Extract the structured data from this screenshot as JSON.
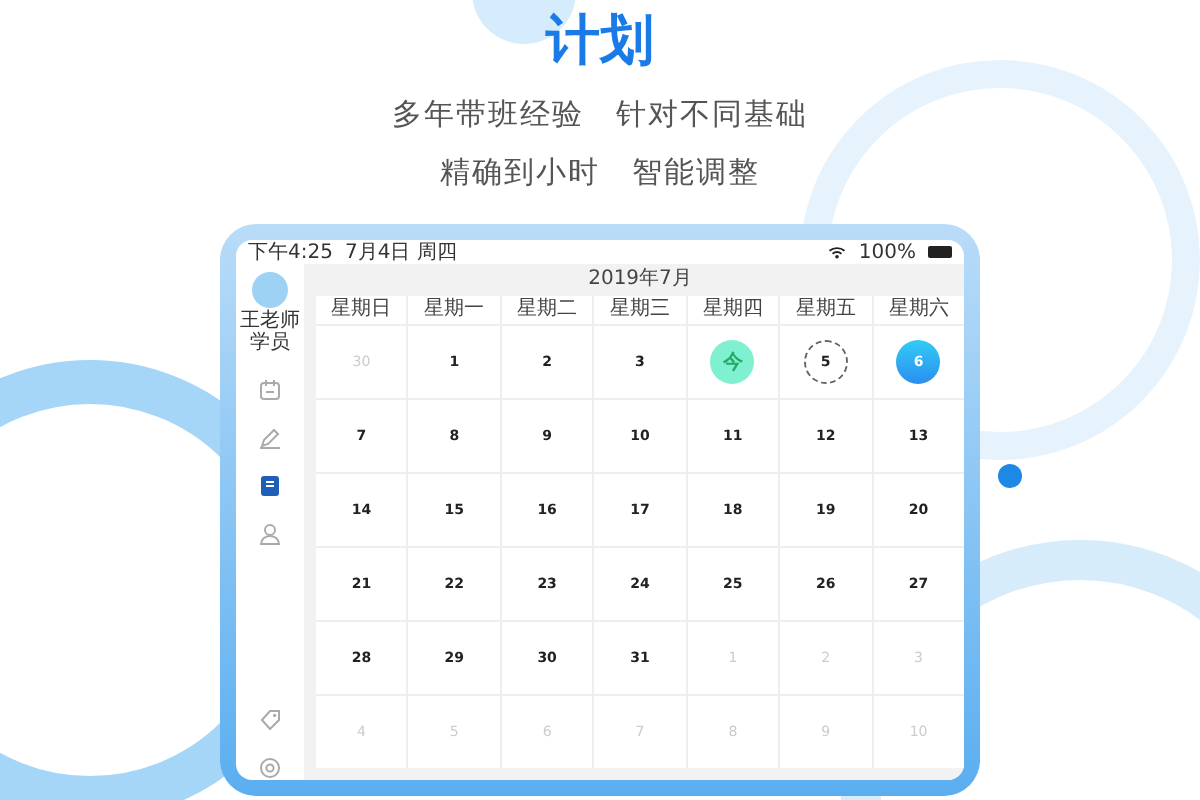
{
  "header": {
    "title": "计划",
    "lines": [
      "多年带班经验　针对不同基础",
      "精确到小时　智能调整"
    ]
  },
  "status_bar": {
    "time": "下午4:25",
    "date": "7月4日 周四",
    "battery": "100%"
  },
  "sidebar": {
    "user_name": "王老师学员",
    "items": [
      {
        "selected": false
      },
      {
        "selected": false
      },
      {
        "selected": true
      },
      {
        "selected": false
      }
    ],
    "bottom_items": [
      {
        "selected": false
      },
      {
        "selected": false
      }
    ]
  },
  "calendar": {
    "month": "2019年7月",
    "weekdays": [
      "星期日",
      "星期一",
      "星期二",
      "星期三",
      "星期四",
      "星期五",
      "星期六"
    ],
    "weeks": [
      [
        {
          "label": "30",
          "kind": "other"
        },
        {
          "label": "1",
          "kind": "day"
        },
        {
          "label": "2",
          "kind": "day"
        },
        {
          "label": "3",
          "kind": "day"
        },
        {
          "label": "今",
          "kind": "today"
        },
        {
          "label": "5",
          "kind": "dashed"
        },
        {
          "label": "6",
          "kind": "filled"
        }
      ],
      [
        {
          "label": "7",
          "kind": "day"
        },
        {
          "label": "8",
          "kind": "day"
        },
        {
          "label": "9",
          "kind": "day"
        },
        {
          "label": "10",
          "kind": "day"
        },
        {
          "label": "11",
          "kind": "day"
        },
        {
          "label": "12",
          "kind": "day"
        },
        {
          "label": "13",
          "kind": "day"
        }
      ],
      [
        {
          "label": "14",
          "kind": "day"
        },
        {
          "label": "15",
          "kind": "day"
        },
        {
          "label": "16",
          "kind": "day"
        },
        {
          "label": "17",
          "kind": "day"
        },
        {
          "label": "18",
          "kind": "day"
        },
        {
          "label": "19",
          "kind": "day"
        },
        {
          "label": "20",
          "kind": "day"
        }
      ],
      [
        {
          "label": "21",
          "kind": "day"
        },
        {
          "label": "22",
          "kind": "day"
        },
        {
          "label": "23",
          "kind": "day"
        },
        {
          "label": "24",
          "kind": "day"
        },
        {
          "label": "25",
          "kind": "day"
        },
        {
          "label": "26",
          "kind": "day"
        },
        {
          "label": "27",
          "kind": "day"
        }
      ],
      [
        {
          "label": "28",
          "kind": "day"
        },
        {
          "label": "29",
          "kind": "day"
        },
        {
          "label": "30",
          "kind": "day"
        },
        {
          "label": "31",
          "kind": "day"
        },
        {
          "label": "1",
          "kind": "other"
        },
        {
          "label": "2",
          "kind": "other"
        },
        {
          "label": "3",
          "kind": "other"
        }
      ],
      [
        {
          "label": "4",
          "kind": "other"
        },
        {
          "label": "5",
          "kind": "other"
        },
        {
          "label": "6",
          "kind": "other"
        },
        {
          "label": "7",
          "kind": "other"
        },
        {
          "label": "8",
          "kind": "other"
        },
        {
          "label": "9",
          "kind": "other"
        },
        {
          "label": "10",
          "kind": "other"
        }
      ]
    ]
  }
}
